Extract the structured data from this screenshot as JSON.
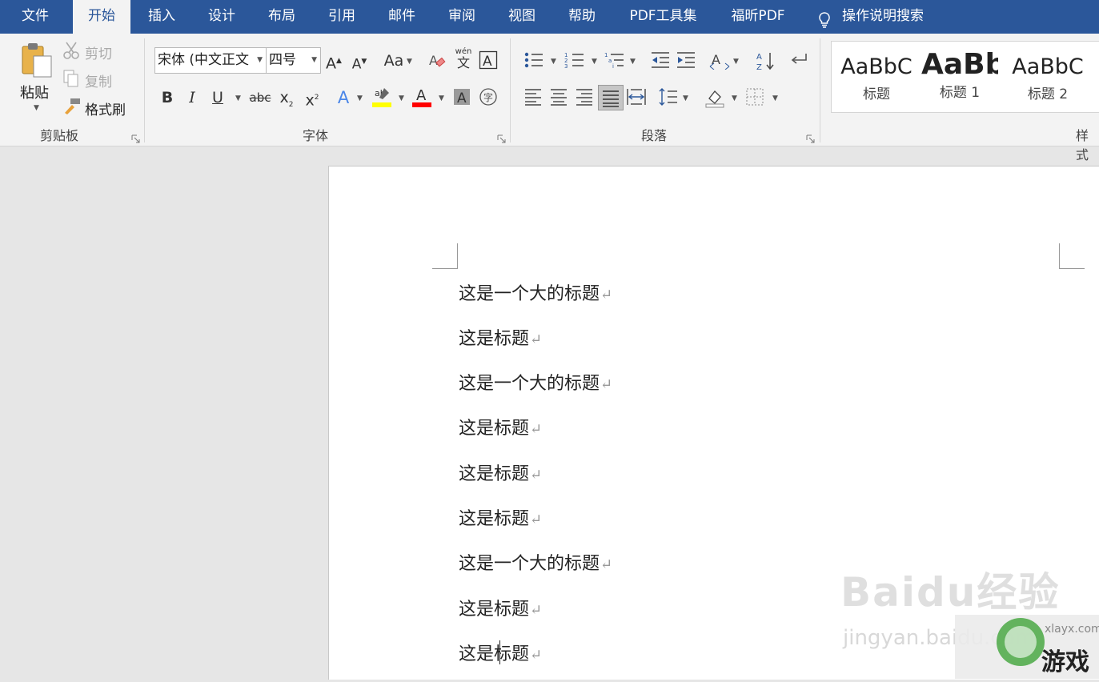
{
  "tabs": [
    "文件",
    "开始",
    "插入",
    "设计",
    "布局",
    "引用",
    "邮件",
    "审阅",
    "视图",
    "帮助",
    "PDF工具集",
    "福昕PDF"
  ],
  "active_tab": "开始",
  "tell_me": "操作说明搜索",
  "clipboard": {
    "paste": "粘贴",
    "cut": "剪切",
    "copy": "复制",
    "format_painter": "格式刷",
    "group_label": "剪贴板"
  },
  "font": {
    "font_name": "宋体 (中文正文",
    "font_size": "四号",
    "change_case": "Aa",
    "phonetic_guide_top": "wén",
    "phonetic_guide_bottom": "文",
    "group_label": "字体",
    "highlight_color": "#ffff00",
    "font_color": "#ff0000"
  },
  "paragraph": {
    "group_label": "段落"
  },
  "styles": {
    "group_label": "样式",
    "items": [
      {
        "sample": "AaBbC",
        "name": "标题"
      },
      {
        "sample": "AaBb",
        "name": "标题 1"
      },
      {
        "sample": "AaBbC",
        "name": "标题 2"
      }
    ]
  },
  "document": {
    "paragraphs": [
      "这是一个大的标题",
      "这是标题",
      "这是一个大的标题",
      "这是标题",
      "这是标题",
      "这是标题",
      "这是一个大的标题",
      "这是标题",
      "这是标题"
    ],
    "paragraph_mark": "↵"
  },
  "watermark": {
    "main": "Baidu经验",
    "sub": "jingyan.baidu.com",
    "game_site": "xlayx.com",
    "game_brand": "游戏"
  },
  "colors": {
    "accent": "#2b579a",
    "ribbon_bg": "#f3f3f3",
    "doc_bg": "#ffffff",
    "canvas_bg": "#e6e6e6"
  }
}
